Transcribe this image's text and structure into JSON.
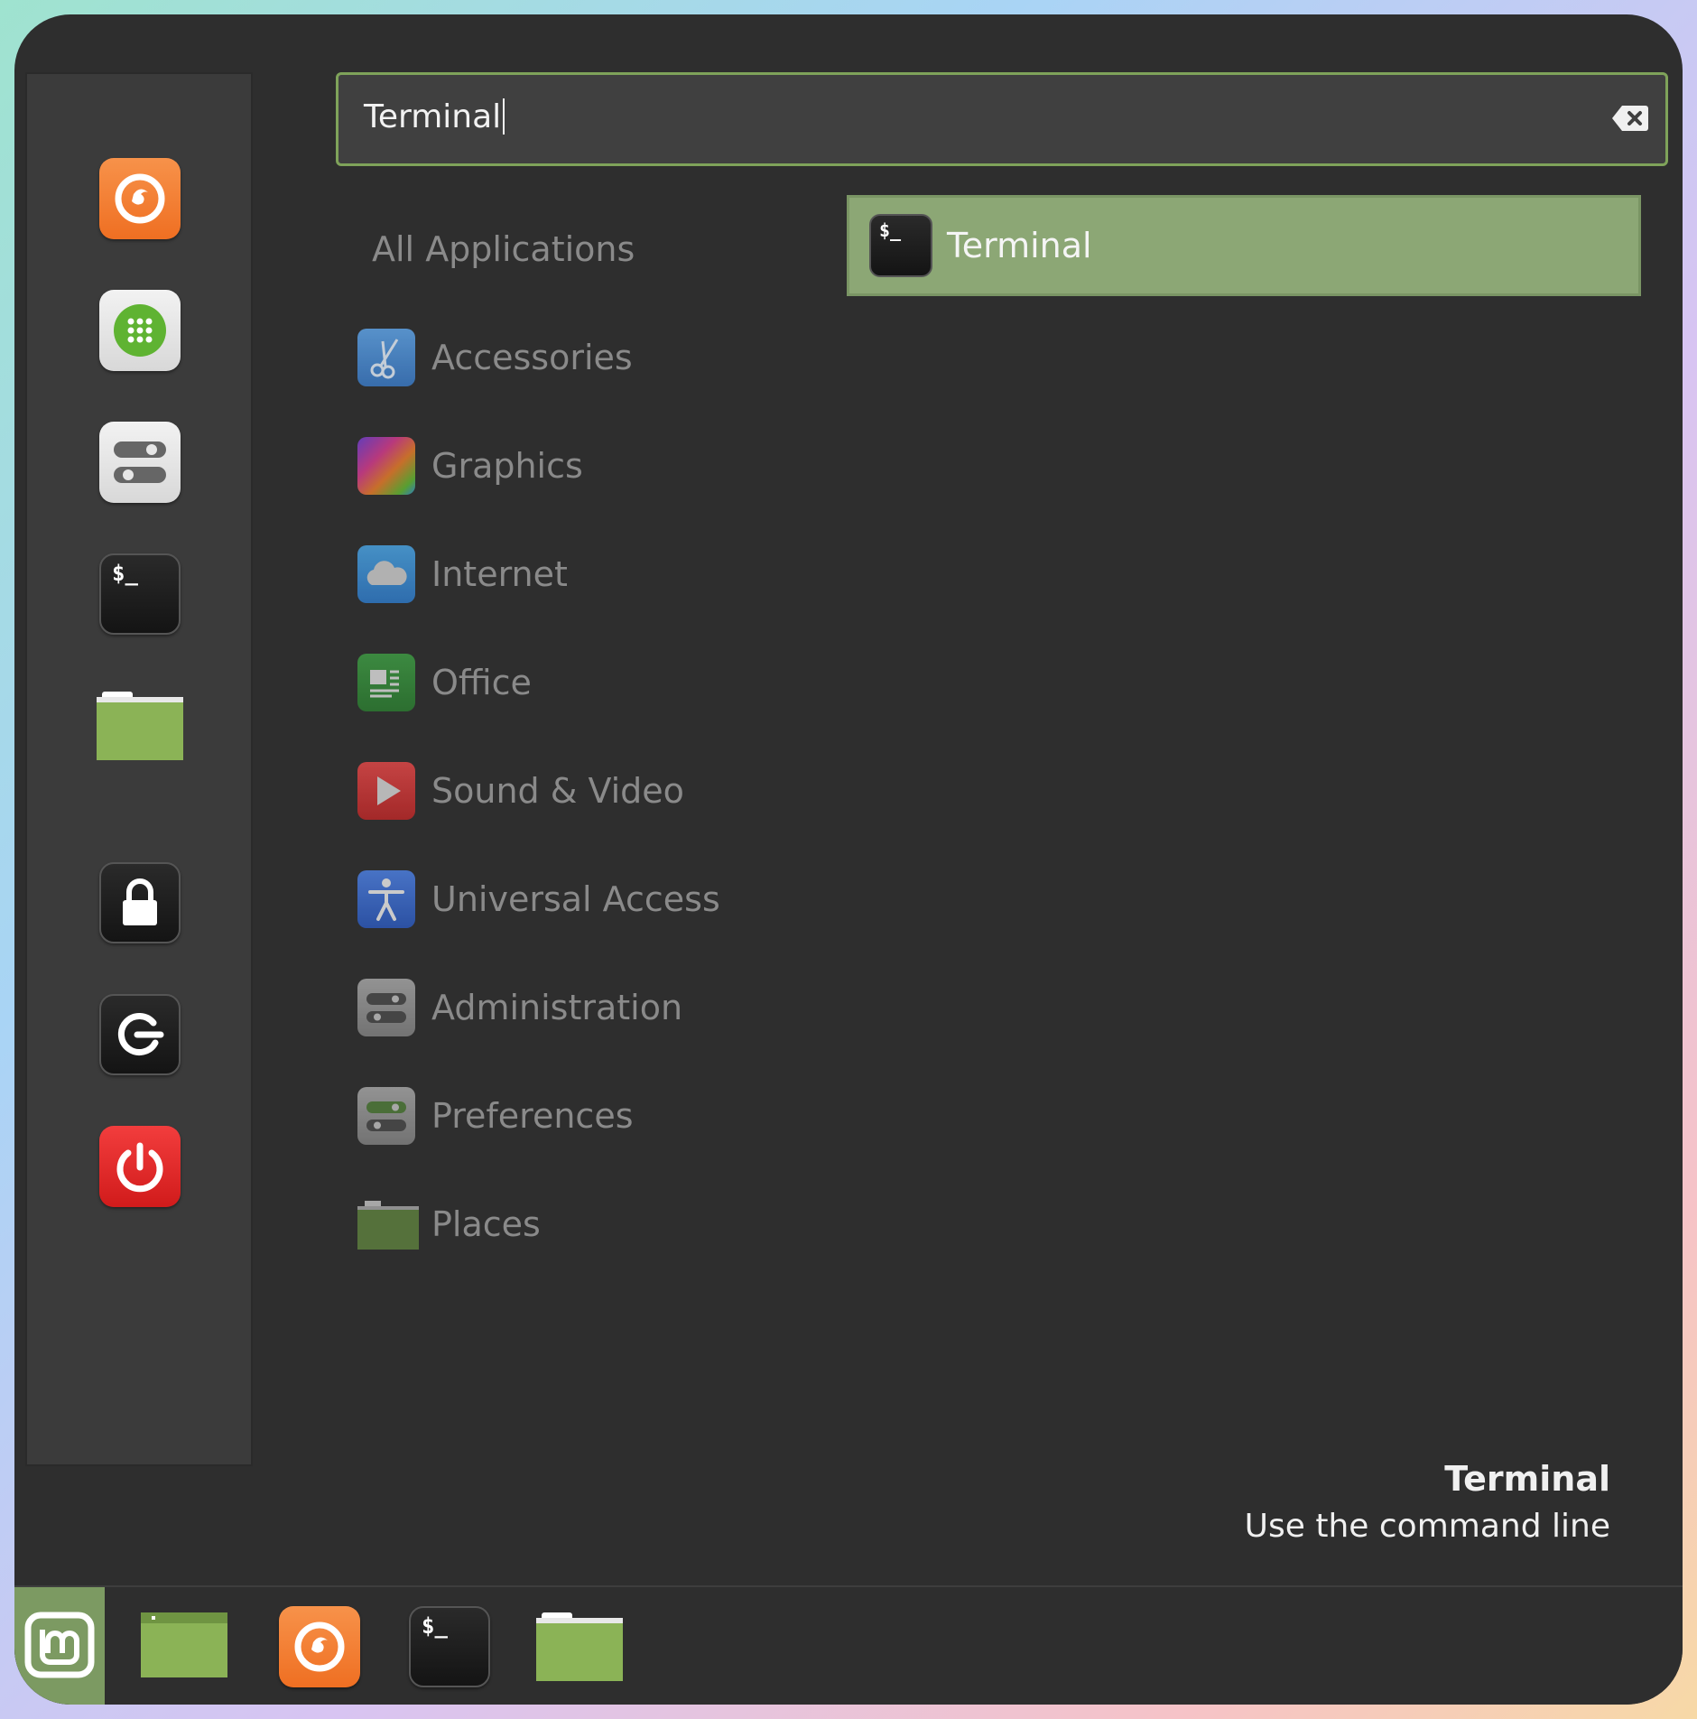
{
  "search": {
    "value": "Terminal",
    "clear_icon": "backspace-clear-icon"
  },
  "favorites": [
    {
      "name": "firefox",
      "icon": "firefox-icon"
    },
    {
      "name": "software-manager",
      "icon": "apps-grid-icon"
    },
    {
      "name": "system-settings",
      "icon": "toggle-switches-icon"
    },
    {
      "name": "terminal",
      "icon": "terminal-icon"
    },
    {
      "name": "files",
      "icon": "folder-icon"
    }
  ],
  "session": [
    {
      "name": "lock-screen",
      "icon": "lock-icon"
    },
    {
      "name": "logout",
      "icon": "logout-icon"
    },
    {
      "name": "shutdown",
      "icon": "power-icon"
    }
  ],
  "categories": {
    "all": "All Applications",
    "items": [
      {
        "label": "Accessories",
        "icon": "scissors-icon",
        "color": "#4f8fd6"
      },
      {
        "label": "Graphics",
        "icon": "color-palette-icon",
        "color": "#c44bc0"
      },
      {
        "label": "Internet",
        "icon": "cloud-icon",
        "color": "#3f8fd0"
      },
      {
        "label": "Office",
        "icon": "document-icon",
        "color": "#3a8a3e"
      },
      {
        "label": "Sound & Video",
        "icon": "play-icon",
        "color": "#d63b3b"
      },
      {
        "label": "Universal Access",
        "icon": "accessibility-icon",
        "color": "#3d6fd1"
      },
      {
        "label": "Administration",
        "icon": "settings-switches-icon",
        "color": "#9a9a9a"
      },
      {
        "label": "Preferences",
        "icon": "preferences-switches-icon",
        "color": "#9a9a9a"
      },
      {
        "label": "Places",
        "icon": "folder-icon",
        "color": "#6a8f48"
      }
    ]
  },
  "results": [
    {
      "label": "Terminal",
      "icon": "terminal-icon"
    }
  ],
  "description": {
    "title": "Terminal",
    "text": "Use the command line"
  },
  "taskbar": {
    "menu_icon": "linux-mint-logo-icon",
    "items": [
      {
        "name": "show-desktop",
        "icon": "desktop-icon"
      },
      {
        "name": "firefox",
        "icon": "firefox-icon"
      },
      {
        "name": "terminal",
        "icon": "terminal-icon"
      },
      {
        "name": "files",
        "icon": "folder-icon"
      }
    ]
  },
  "colors": {
    "accent": "#8ca775",
    "search_border": "#7fa35a",
    "panel": "#2e2e2e",
    "sidebar": "#3b3b3b"
  }
}
